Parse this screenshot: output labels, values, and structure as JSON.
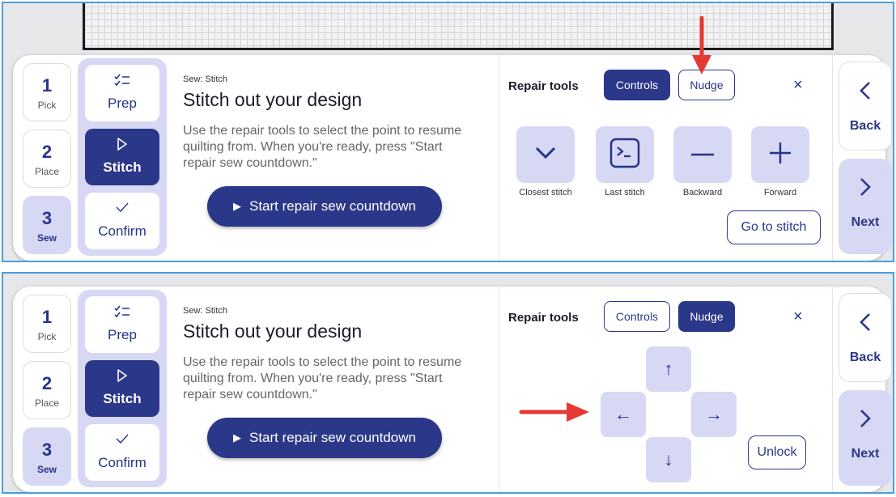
{
  "steps": [
    {
      "num": "1",
      "label": "Pick"
    },
    {
      "num": "2",
      "label": "Place"
    },
    {
      "num": "3",
      "label": "Sew"
    }
  ],
  "substeps": [
    {
      "label": "Prep",
      "icon": "checklist-icon"
    },
    {
      "label": "Stitch",
      "icon": "play-outline-icon"
    },
    {
      "label": "Confirm",
      "icon": "checkmark-icon"
    }
  ],
  "content": {
    "breadcrumb": "Sew: Stitch",
    "title": "Stitch out your design",
    "description": "Use the repair tools to select the point to resume quilting from. When you're ready, press \"Start repair sew countdown.\"",
    "start_button": "Start repair sew countdown"
  },
  "repair": {
    "label": "Repair tools",
    "tab_controls": "Controls",
    "tab_nudge": "Nudge",
    "close": "×",
    "tools": [
      {
        "label": "Closest stitch",
        "icon": "chevron-down-icon"
      },
      {
        "label": "Last stitch",
        "icon": "terminal-icon"
      },
      {
        "label": "Backward",
        "icon": "minus-icon"
      },
      {
        "label": "Forward",
        "icon": "plus-icon"
      }
    ],
    "goto_button": "Go to stitch",
    "unlock_button": "Unlock",
    "arrows": {
      "up": "↑",
      "left": "←",
      "right": "→",
      "down": "↓"
    }
  },
  "nav": {
    "back": "Back",
    "next": "Next",
    "back_icon": "‹",
    "next_icon": "›"
  },
  "shots": [
    {
      "active_tab": "Controls"
    },
    {
      "active_tab": "Nudge"
    }
  ],
  "colors": {
    "primary": "#2b3788",
    "light": "#d7d8f3",
    "frame": "#4a9edb",
    "annotation": "#e53935"
  }
}
